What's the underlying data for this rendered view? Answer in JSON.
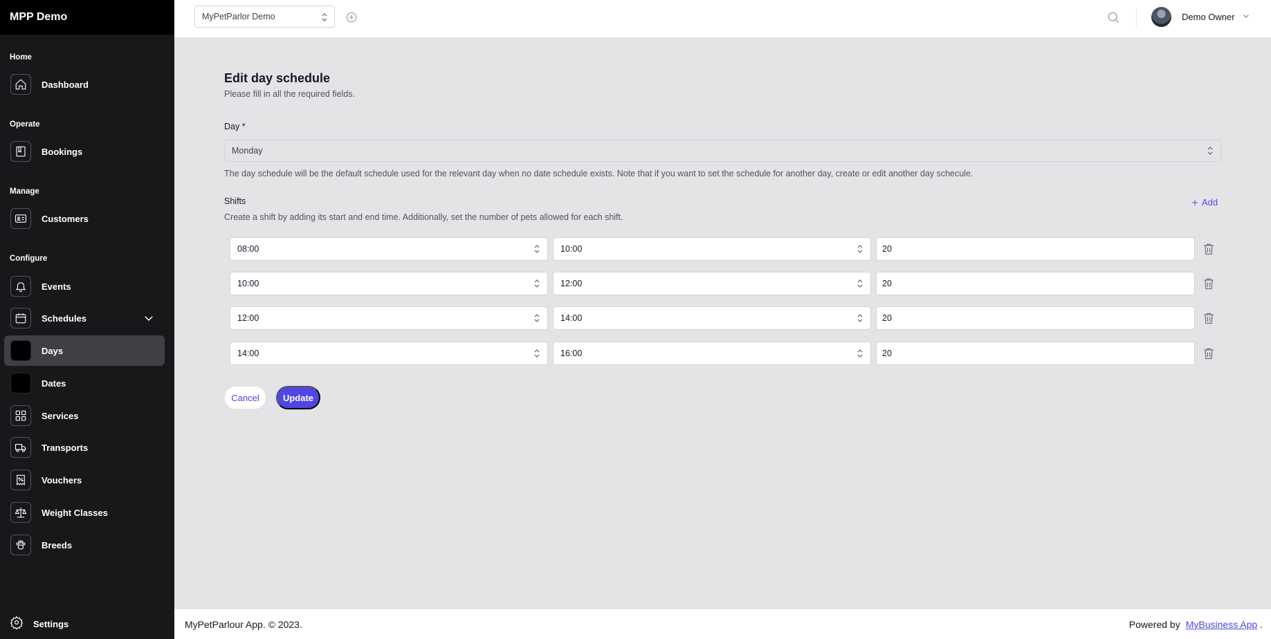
{
  "app": {
    "brand": "MPP Demo"
  },
  "sidebar": {
    "groups": {
      "home": "Home",
      "operate": "Operate",
      "manage": "Manage",
      "configure": "Configure"
    },
    "items": {
      "dashboard": {
        "label": "Dashboard",
        "icon": "home-icon"
      },
      "bookings": {
        "label": "Bookings",
        "icon": "book-icon"
      },
      "customers": {
        "label": "Customers",
        "icon": "id-card-icon"
      },
      "events": {
        "label": "Events",
        "icon": "bell-icon"
      },
      "schedules": {
        "label": "Schedules",
        "icon": "calendar-icon"
      },
      "days": {
        "label": "Days",
        "icon": "square-icon",
        "active": true
      },
      "dates": {
        "label": "Dates",
        "icon": "square-icon"
      },
      "services": {
        "label": "Services",
        "icon": "grid-icon"
      },
      "transports": {
        "label": "Transports",
        "icon": "truck-icon"
      },
      "vouchers": {
        "label": "Vouchers",
        "icon": "voucher-icon"
      },
      "weight_classes": {
        "label": "Weight Classes",
        "icon": "scale-icon"
      },
      "breeds": {
        "label": "Breeds",
        "icon": "paw-icon"
      }
    },
    "settings": "Settings"
  },
  "topbar": {
    "organization": "MyPetParlor Demo",
    "user_name": "Demo Owner"
  },
  "form": {
    "title": "Edit day schedule",
    "subtitle": "Please fill in all the required fields.",
    "day_label": "Day *",
    "day_value": "Monday",
    "day_help": "The day schedule will be the default schedule used for the relevant day when no date schedule exists. Note that if you want to set the schedule for another day, create or edit another day schecule.",
    "shifts_label": "Shifts",
    "shifts_help": "Create a shift by adding its start and end time. Additionally, set the number of pets allowed for each shift.",
    "add_label": "Add",
    "shifts": [
      {
        "start": "08:00",
        "end": "10:00",
        "pets": "20"
      },
      {
        "start": "10:00",
        "end": "12:00",
        "pets": "20"
      },
      {
        "start": "12:00",
        "end": "14:00",
        "pets": "20"
      },
      {
        "start": "14:00",
        "end": "16:00",
        "pets": "20"
      }
    ],
    "cancel_label": "Cancel",
    "update_label": "Update"
  },
  "footer": {
    "copyright": "MyPetParlour App. © 2023.",
    "powered_by": "Powered by",
    "link_text": "MyBusiness App",
    "suffix": "."
  },
  "colors": {
    "accent": "#4f46e5",
    "sidebar_bg": "#18181b",
    "content_bg": "#e4e4e7"
  }
}
